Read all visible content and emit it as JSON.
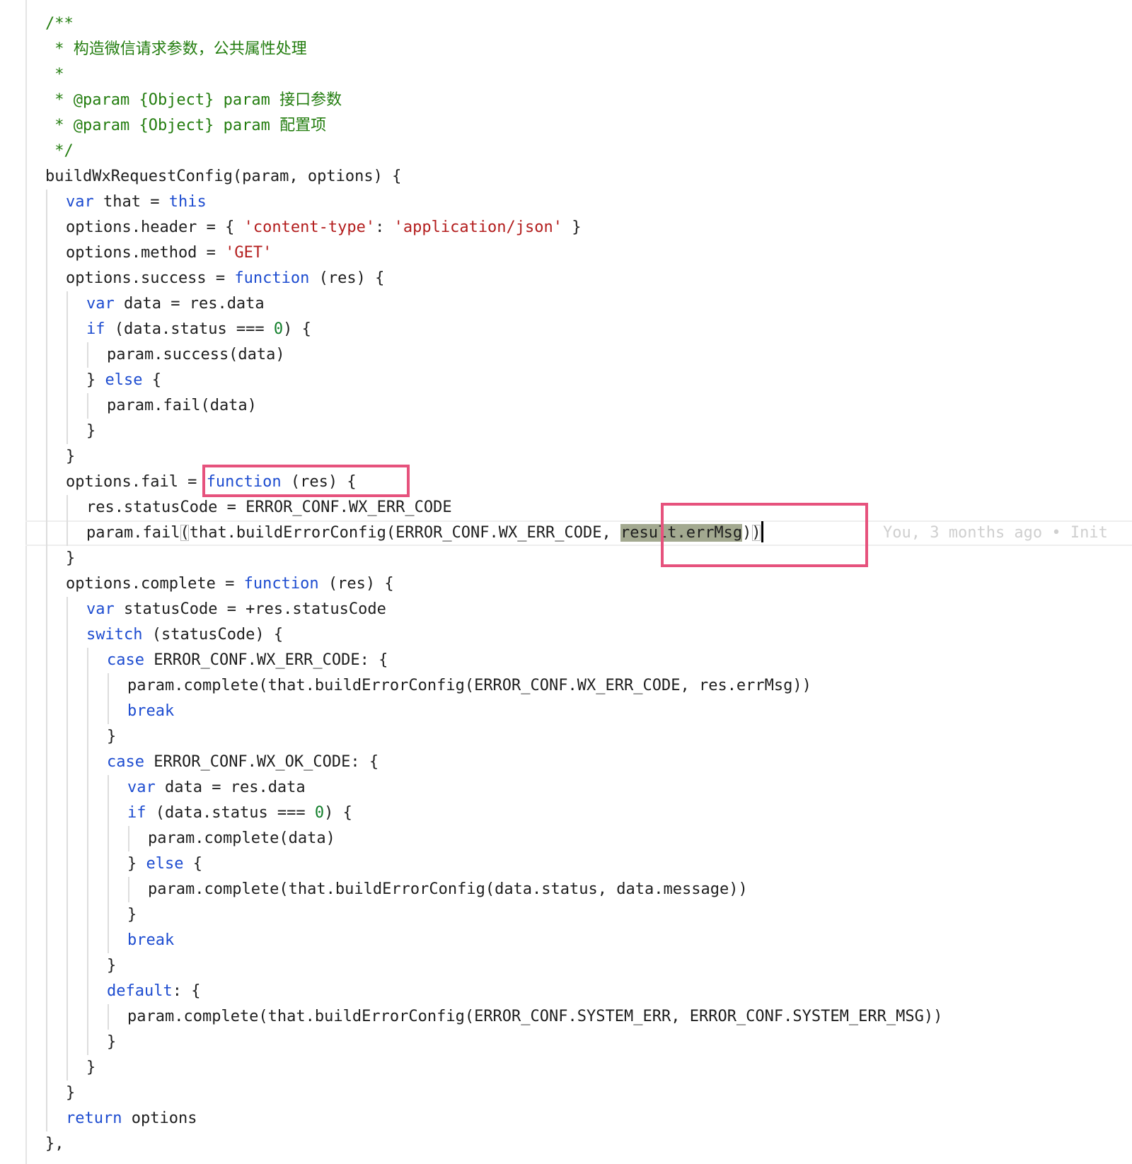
{
  "editor": {
    "lines": [
      {
        "indent": 0,
        "tokens": [
          {
            "t": "/**",
            "c": "comment"
          }
        ]
      },
      {
        "indent": 0,
        "tokens": [
          {
            "t": " * 构造微信请求参数，公共属性处理",
            "c": "comment"
          }
        ]
      },
      {
        "indent": 0,
        "tokens": [
          {
            "t": " *",
            "c": "comment"
          }
        ]
      },
      {
        "indent": 0,
        "tokens": [
          {
            "t": " * @param {Object} param 接口参数",
            "c": "comment"
          }
        ]
      },
      {
        "indent": 0,
        "tokens": [
          {
            "t": " * @param {Object} param 配置项",
            "c": "comment"
          }
        ]
      },
      {
        "indent": 0,
        "tokens": [
          {
            "t": " */",
            "c": "comment"
          }
        ]
      },
      {
        "indent": 0,
        "tokens": [
          {
            "t": "buildWxRequestConfig(param, options) {",
            "c": "plain"
          }
        ]
      },
      {
        "indent": 1,
        "tokens": [
          {
            "t": "var",
            "c": "kw"
          },
          {
            "t": " that = ",
            "c": "plain"
          },
          {
            "t": "this",
            "c": "kw"
          }
        ]
      },
      {
        "indent": 1,
        "tokens": [
          {
            "t": "options.header = { ",
            "c": "plain"
          },
          {
            "t": "'content-type'",
            "c": "str"
          },
          {
            "t": ": ",
            "c": "plain"
          },
          {
            "t": "'application/json'",
            "c": "str"
          },
          {
            "t": " }",
            "c": "plain"
          }
        ]
      },
      {
        "indent": 1,
        "tokens": [
          {
            "t": "options.method = ",
            "c": "plain"
          },
          {
            "t": "'GET'",
            "c": "str"
          }
        ]
      },
      {
        "indent": 1,
        "tokens": [
          {
            "t": "options.success = ",
            "c": "plain"
          },
          {
            "t": "function",
            "c": "kw"
          },
          {
            "t": " (res) {",
            "c": "plain"
          }
        ]
      },
      {
        "indent": 2,
        "tokens": [
          {
            "t": "var",
            "c": "kw"
          },
          {
            "t": " data = res.data",
            "c": "plain"
          }
        ]
      },
      {
        "indent": 2,
        "tokens": [
          {
            "t": "if",
            "c": "kw"
          },
          {
            "t": " (data.status === ",
            "c": "plain"
          },
          {
            "t": "0",
            "c": "num"
          },
          {
            "t": ") {",
            "c": "plain"
          }
        ]
      },
      {
        "indent": 3,
        "tokens": [
          {
            "t": "param.success(data)",
            "c": "plain"
          }
        ]
      },
      {
        "indent": 2,
        "tokens": [
          {
            "t": "} ",
            "c": "plain"
          },
          {
            "t": "else",
            "c": "kw"
          },
          {
            "t": " {",
            "c": "plain"
          }
        ]
      },
      {
        "indent": 3,
        "tokens": [
          {
            "t": "param.fail(data)",
            "c": "plain"
          }
        ]
      },
      {
        "indent": 2,
        "tokens": [
          {
            "t": "}",
            "c": "plain"
          }
        ]
      },
      {
        "indent": 1,
        "tokens": [
          {
            "t": "}",
            "c": "plain"
          }
        ]
      },
      {
        "indent": 1,
        "tokens": [
          {
            "t": "options.fail = ",
            "c": "plain"
          },
          {
            "t": "function",
            "c": "kw"
          },
          {
            "t": " (res) {",
            "c": "plain"
          }
        ]
      },
      {
        "indent": 2,
        "tokens": [
          {
            "t": "res.statusCode = ERROR_CONF.WX_ERR_CODE",
            "c": "plain"
          }
        ]
      },
      {
        "indent": 2,
        "current": true,
        "tokens": [
          {
            "t": "param.fail",
            "c": "plain"
          },
          {
            "t": "(",
            "c": "bracket"
          },
          {
            "t": "that.buildErrorConfig(ERROR_CONF.WX_ERR_CODE, ",
            "c": "plain"
          },
          {
            "t": "result.errMsg",
            "c": "sel"
          },
          {
            "t": ")",
            "c": "plain"
          },
          {
            "t": ")",
            "c": "bracket"
          },
          {
            "t": "",
            "c": "cursor"
          }
        ]
      },
      {
        "indent": 1,
        "tokens": [
          {
            "t": "}",
            "c": "plain"
          }
        ]
      },
      {
        "indent": 1,
        "tokens": [
          {
            "t": "options.complete = ",
            "c": "plain"
          },
          {
            "t": "function",
            "c": "kw"
          },
          {
            "t": " (res) {",
            "c": "plain"
          }
        ]
      },
      {
        "indent": 2,
        "tokens": [
          {
            "t": "var",
            "c": "kw"
          },
          {
            "t": " statusCode = +res.statusCode",
            "c": "plain"
          }
        ]
      },
      {
        "indent": 2,
        "tokens": [
          {
            "t": "switch",
            "c": "kw"
          },
          {
            "t": " (statusCode) {",
            "c": "plain"
          }
        ]
      },
      {
        "indent": 3,
        "tokens": [
          {
            "t": "case",
            "c": "kw"
          },
          {
            "t": " ERROR_CONF.WX_ERR_CODE: {",
            "c": "plain"
          }
        ]
      },
      {
        "indent": 4,
        "tokens": [
          {
            "t": "param.complete(that.buildErrorConfig(ERROR_CONF.WX_ERR_CODE, res.errMsg))",
            "c": "plain"
          }
        ]
      },
      {
        "indent": 4,
        "tokens": [
          {
            "t": "break",
            "c": "kw"
          }
        ]
      },
      {
        "indent": 3,
        "tokens": [
          {
            "t": "}",
            "c": "plain"
          }
        ]
      },
      {
        "indent": 3,
        "tokens": [
          {
            "t": "case",
            "c": "kw"
          },
          {
            "t": " ERROR_CONF.WX_OK_CODE: {",
            "c": "plain"
          }
        ]
      },
      {
        "indent": 4,
        "tokens": [
          {
            "t": "var",
            "c": "kw"
          },
          {
            "t": " data = res.data",
            "c": "plain"
          }
        ]
      },
      {
        "indent": 4,
        "tokens": [
          {
            "t": "if",
            "c": "kw"
          },
          {
            "t": " (data.status === ",
            "c": "plain"
          },
          {
            "t": "0",
            "c": "num"
          },
          {
            "t": ") {",
            "c": "plain"
          }
        ]
      },
      {
        "indent": 5,
        "tokens": [
          {
            "t": "param.complete(data)",
            "c": "plain"
          }
        ]
      },
      {
        "indent": 4,
        "tokens": [
          {
            "t": "} ",
            "c": "plain"
          },
          {
            "t": "else",
            "c": "kw"
          },
          {
            "t": " {",
            "c": "plain"
          }
        ]
      },
      {
        "indent": 5,
        "tokens": [
          {
            "t": "param.complete(that.buildErrorConfig(data.status, data.message))",
            "c": "plain"
          }
        ]
      },
      {
        "indent": 4,
        "tokens": [
          {
            "t": "}",
            "c": "plain"
          }
        ]
      },
      {
        "indent": 4,
        "tokens": [
          {
            "t": "break",
            "c": "kw"
          }
        ]
      },
      {
        "indent": 3,
        "tokens": [
          {
            "t": "}",
            "c": "plain"
          }
        ]
      },
      {
        "indent": 3,
        "tokens": [
          {
            "t": "default",
            "c": "kw"
          },
          {
            "t": ": {",
            "c": "plain"
          }
        ]
      },
      {
        "indent": 4,
        "tokens": [
          {
            "t": "param.complete(that.buildErrorConfig(ERROR_CONF.SYSTEM_ERR, ERROR_CONF.SYSTEM_ERR_MSG))",
            "c": "plain"
          }
        ]
      },
      {
        "indent": 3,
        "tokens": [
          {
            "t": "}",
            "c": "plain"
          }
        ]
      },
      {
        "indent": 2,
        "tokens": [
          {
            "t": "}",
            "c": "plain"
          }
        ]
      },
      {
        "indent": 1,
        "tokens": [
          {
            "t": "}",
            "c": "plain"
          }
        ]
      },
      {
        "indent": 1,
        "tokens": [
          {
            "t": "return",
            "c": "kw"
          },
          {
            "t": " options",
            "c": "plain"
          }
        ]
      },
      {
        "indent": 0,
        "tokens": [
          {
            "t": "},",
            "c": "plain"
          }
        ]
      }
    ],
    "blame_annotation": "You, 3 months ago • Init",
    "colors": {
      "comment": "#237d0f",
      "keyword": "#1d4cd0",
      "string": "#b31d1d",
      "number": "#117e2a",
      "selection": "#a3a990",
      "highlight_box": "#e6527d"
    }
  }
}
